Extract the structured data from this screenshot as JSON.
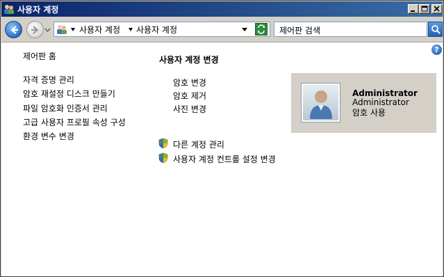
{
  "window": {
    "title": "사용자 계정"
  },
  "address": {
    "crumbs": [
      "사용자 계정",
      "사용자 계정"
    ]
  },
  "search": {
    "placeholder": "제어판 검색"
  },
  "sidebar": {
    "home": "제어판 홈",
    "links": [
      "자격 증명 관리",
      "암호 재설정 디스크 만들기",
      "파일 암호화 인증서 관리",
      "고급 사용자 프로필 속성 구성",
      "환경 변수 변경"
    ]
  },
  "main": {
    "title": "사용자 계정 변경",
    "tasks": [
      "암호 변경",
      "암호 제거",
      "사진 변경"
    ],
    "admin_tasks": [
      "다른 계정 관리",
      "사용자 계정 컨트롤 설정 변경"
    ]
  },
  "account": {
    "name": "Administrator",
    "type": "Administrator",
    "status": "암호 사용"
  },
  "icons": {
    "title": "users-icon",
    "back": "back-arrow-icon",
    "forward": "forward-arrow-icon",
    "address": "control-panel-icon",
    "refresh": "refresh-icon",
    "search": "search-icon",
    "help": "help-icon",
    "shield": "uac-shield-icon",
    "avatar": "user-avatar-icon"
  },
  "colors": {
    "titlebar_start": "#0a246a",
    "titlebar_end": "#3a6ea5",
    "window_face": "#d4d0c8"
  }
}
